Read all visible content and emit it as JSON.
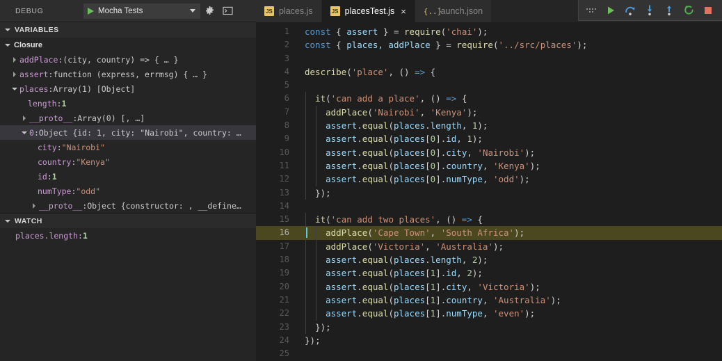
{
  "debug_panel": {
    "title": "DEBUG",
    "launch_config": "Mocha Tests",
    "start_icon": "play-icon",
    "dropdown_icon": "chevron-down-icon",
    "settings_icon": "gear-icon",
    "console_icon": "terminal-icon",
    "sections": {
      "variables": {
        "title": "VARIABLES",
        "scope": "Closure"
      },
      "watch": {
        "title": "WATCH"
      }
    },
    "variables": [
      {
        "indent": 1,
        "twisty": "right",
        "name": "addPlace",
        "sep": ": ",
        "value": "(city, country) => { … }",
        "vtype": "fn",
        "selected": false
      },
      {
        "indent": 1,
        "twisty": "right",
        "name": "assert",
        "sep": ": ",
        "value": "function (express, errmsg) { … }",
        "vtype": "fn",
        "selected": false
      },
      {
        "indent": 1,
        "twisty": "down",
        "name": "places",
        "sep": ": ",
        "value": "Array(1) [Object]",
        "vtype": "fn",
        "selected": false
      },
      {
        "indent": 2,
        "twisty": "none",
        "name": "length",
        "sep": ": ",
        "value": "1",
        "vtype": "num",
        "selected": false
      },
      {
        "indent": 2,
        "twisty": "right",
        "name": "__proto__",
        "sep": ": ",
        "value": "Array(0) [, …]",
        "vtype": "fn",
        "selected": false
      },
      {
        "indent": 2,
        "twisty": "down",
        "name": "0",
        "sep": ": ",
        "value": "Object {id: 1, city: \"Nairobi\", country: …",
        "vtype": "fn",
        "selected": true
      },
      {
        "indent": 3,
        "twisty": "none",
        "name": "city",
        "sep": ": ",
        "value": "\"Nairobi\"",
        "vtype": "str",
        "selected": false
      },
      {
        "indent": 3,
        "twisty": "none",
        "name": "country",
        "sep": ": ",
        "value": "\"Kenya\"",
        "vtype": "str",
        "selected": false
      },
      {
        "indent": 3,
        "twisty": "none",
        "name": "id",
        "sep": ": ",
        "value": "1",
        "vtype": "num",
        "selected": false
      },
      {
        "indent": 3,
        "twisty": "none",
        "name": "numType",
        "sep": ": ",
        "value": "\"odd\"",
        "vtype": "str",
        "selected": false
      },
      {
        "indent": 3,
        "twisty": "right",
        "name": "__proto__",
        "sep": ": ",
        "value": "Object {constructor: , __define…",
        "vtype": "fn",
        "selected": false
      }
    ],
    "watch": [
      {
        "name": "places.length",
        "sep": ": ",
        "value": "1",
        "vtype": "num"
      }
    ]
  },
  "debug_toolbar": {
    "grip": "drag-handle-icon",
    "buttons": [
      {
        "name": "continue-button",
        "icon": "play-icon",
        "title": "Continue"
      },
      {
        "name": "step-over-button",
        "icon": "step-over-icon",
        "title": "Step Over"
      },
      {
        "name": "step-into-button",
        "icon": "step-into-icon",
        "title": "Step Into"
      },
      {
        "name": "step-out-button",
        "icon": "step-out-icon",
        "title": "Step Out"
      },
      {
        "name": "restart-button",
        "icon": "restart-icon",
        "title": "Restart"
      },
      {
        "name": "stop-button",
        "icon": "stop-icon",
        "title": "Stop"
      }
    ],
    "colors": {
      "play": "#6bbf5b",
      "step": "#4a9ede",
      "restart": "#4caf50",
      "stop": "#e8705f"
    }
  },
  "tabs": [
    {
      "label": "places.js",
      "icon": "js-file-icon",
      "badge": "JS",
      "active": false,
      "closable": false
    },
    {
      "label": "placesTest.js",
      "icon": "js-file-icon",
      "badge": "JS",
      "active": true,
      "closable": true,
      "close_label": "×"
    },
    {
      "label": "launch.json",
      "icon": "json-file-icon",
      "badge": "{..}",
      "active": false,
      "closable": false
    }
  ],
  "editor": {
    "current_line": 16,
    "breakpoint_line": 16,
    "lines": [
      {
        "n": 1,
        "text": "const { assert } = require('chai');"
      },
      {
        "n": 2,
        "text": "const { places, addPlace } = require('../src/places');"
      },
      {
        "n": 3,
        "text": ""
      },
      {
        "n": 4,
        "text": "describe('place', () => {"
      },
      {
        "n": 5,
        "text": ""
      },
      {
        "n": 6,
        "text": "  it('can add a place', () => {"
      },
      {
        "n": 7,
        "text": "    addPlace('Nairobi', 'Kenya');"
      },
      {
        "n": 8,
        "text": "    assert.equal(places.length, 1);"
      },
      {
        "n": 9,
        "text": "    assert.equal(places[0].id, 1);"
      },
      {
        "n": 10,
        "text": "    assert.equal(places[0].city, 'Nairobi');"
      },
      {
        "n": 11,
        "text": "    assert.equal(places[0].country, 'Kenya');"
      },
      {
        "n": 12,
        "text": "    assert.equal(places[0].numType, 'odd');"
      },
      {
        "n": 13,
        "text": "  });"
      },
      {
        "n": 14,
        "text": ""
      },
      {
        "n": 15,
        "text": "  it('can add two places', () => {"
      },
      {
        "n": 16,
        "text": "    addPlace('Cape Town', 'South Africa');"
      },
      {
        "n": 17,
        "text": "    addPlace('Victoria', 'Australia');"
      },
      {
        "n": 18,
        "text": "    assert.equal(places.length, 2);"
      },
      {
        "n": 19,
        "text": "    assert.equal(places[1].id, 2);"
      },
      {
        "n": 20,
        "text": "    assert.equal(places[1].city, 'Victoria');"
      },
      {
        "n": 21,
        "text": "    assert.equal(places[1].country, 'Australia');"
      },
      {
        "n": 22,
        "text": "    assert.equal(places[1].numType, 'even');"
      },
      {
        "n": 23,
        "text": "  });"
      },
      {
        "n": 24,
        "text": "});"
      },
      {
        "n": 25,
        "text": ""
      }
    ]
  },
  "colors": {
    "editor_bg": "#1e1e1e",
    "sidebar_bg": "#252526",
    "tabbar_bg": "#252526",
    "active_tab_bg": "#1e1e1e",
    "selection_bg": "#37373d",
    "current_line_bg": "#4b4820",
    "breakpoint": "#e51400",
    "cursor": "#5fc9d8"
  }
}
